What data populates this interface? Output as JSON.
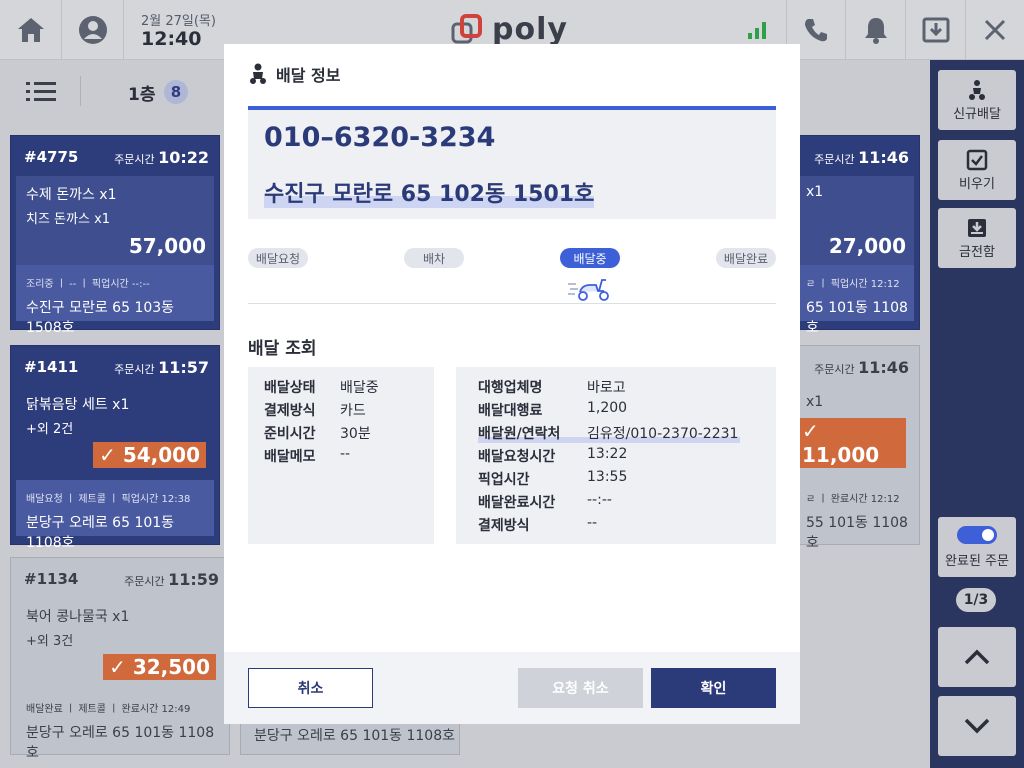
{
  "topbar": {
    "date": "2월 27일(목)",
    "time": "12:40",
    "logo_text": "poly",
    "icons": [
      "home-icon",
      "account-icon",
      "signal-icon",
      "phone-icon",
      "bell-icon",
      "drawer-icon",
      "close-icon"
    ]
  },
  "subbar": {
    "floor": "1층",
    "count": "8"
  },
  "cards": [
    {
      "no": "#4775",
      "time_label": "주문시간",
      "time": "10:22",
      "item1": "수제 돈까스 x1",
      "item2": "치즈 돈까스 x1",
      "price": "57,000",
      "foot1": "조리중  ㅣ  --  ㅣ  픽업시간 --:--",
      "foot2": "수진구 모란로 65 103동 1508호"
    },
    {
      "no": "#1411",
      "time_label": "주문시간",
      "time": "11:57",
      "item1": "닭볶음탕 세트  x1",
      "item2": "+외 2건",
      "price": "54,000",
      "foot1": "배달요청  ㅣ  제트콜  ㅣ  픽업시간 12:38",
      "foot2": "분당구 오레로 65 101동 1108호"
    },
    {
      "no": "#1134",
      "time_label": "주문시간",
      "time": "11:59",
      "item1": "북어 콩나물국  x1",
      "item2": "+외 3건",
      "price": "32,500",
      "foot1": "배달완료  ㅣ  제트콜  ㅣ  완료시간 12:49",
      "foot2": "분당구 오레로 65 101동 1108호"
    },
    {
      "time_label": "주문시간",
      "time": "11:46",
      "item1": "x1",
      "price": "27,000",
      "foot1": "ㄹ  ㅣ  픽업시간 12:12",
      "foot2": "65 101동 1108호"
    },
    {
      "time_label": "주문시간",
      "time": "11:46",
      "item1": "x1",
      "price": "11,000",
      "foot1": "ㄹ  ㅣ  완료시간 12:12",
      "foot2": "55 101동 1108호"
    },
    {
      "foot2": "분당구 오레로 65 101동 1108호"
    }
  ],
  "sidebar": {
    "new_delivery": "신규배달",
    "empty": "비우기",
    "cash_drawer": "금전함",
    "completed_orders": "완료된 주문",
    "page": "1/3"
  },
  "modal": {
    "title": "배달 정보",
    "phone": "010–6320-3234",
    "address": "수진구 모란로 65 102동 1501호",
    "steps": [
      "배달요청",
      "배차",
      "배달중",
      "배달완료"
    ],
    "active_step": 2,
    "section_title": "배달 조회",
    "left_rows": [
      {
        "k": "배달상태",
        "v": "배달중"
      },
      {
        "k": "결제방식",
        "v": "카드"
      },
      {
        "k": "준비시간",
        "v": "30분"
      },
      {
        "k": "배달메모",
        "v": "--"
      }
    ],
    "right_rows": [
      {
        "k": "대행업체명",
        "v": "바로고"
      },
      {
        "k": "배달대행료",
        "v": "1,200"
      },
      {
        "k": "배달원/연락처",
        "v": "김유정/010-2370-2231"
      },
      {
        "k": "배달요청시간",
        "v": "13:22"
      },
      {
        "k": "픽업시간",
        "v": "13:55"
      },
      {
        "k": "배달완료시간",
        "v": "--:--"
      },
      {
        "k": "결제방식",
        "v": "--"
      }
    ],
    "buttons": {
      "cancel": "취소",
      "request_cancel": "요청 취소",
      "confirm": "확인"
    }
  },
  "colors": {
    "accent": "#3d5fd8",
    "navy": "#2b3a78",
    "badge": "#d06a3d",
    "sidebar": "#2a3560"
  }
}
